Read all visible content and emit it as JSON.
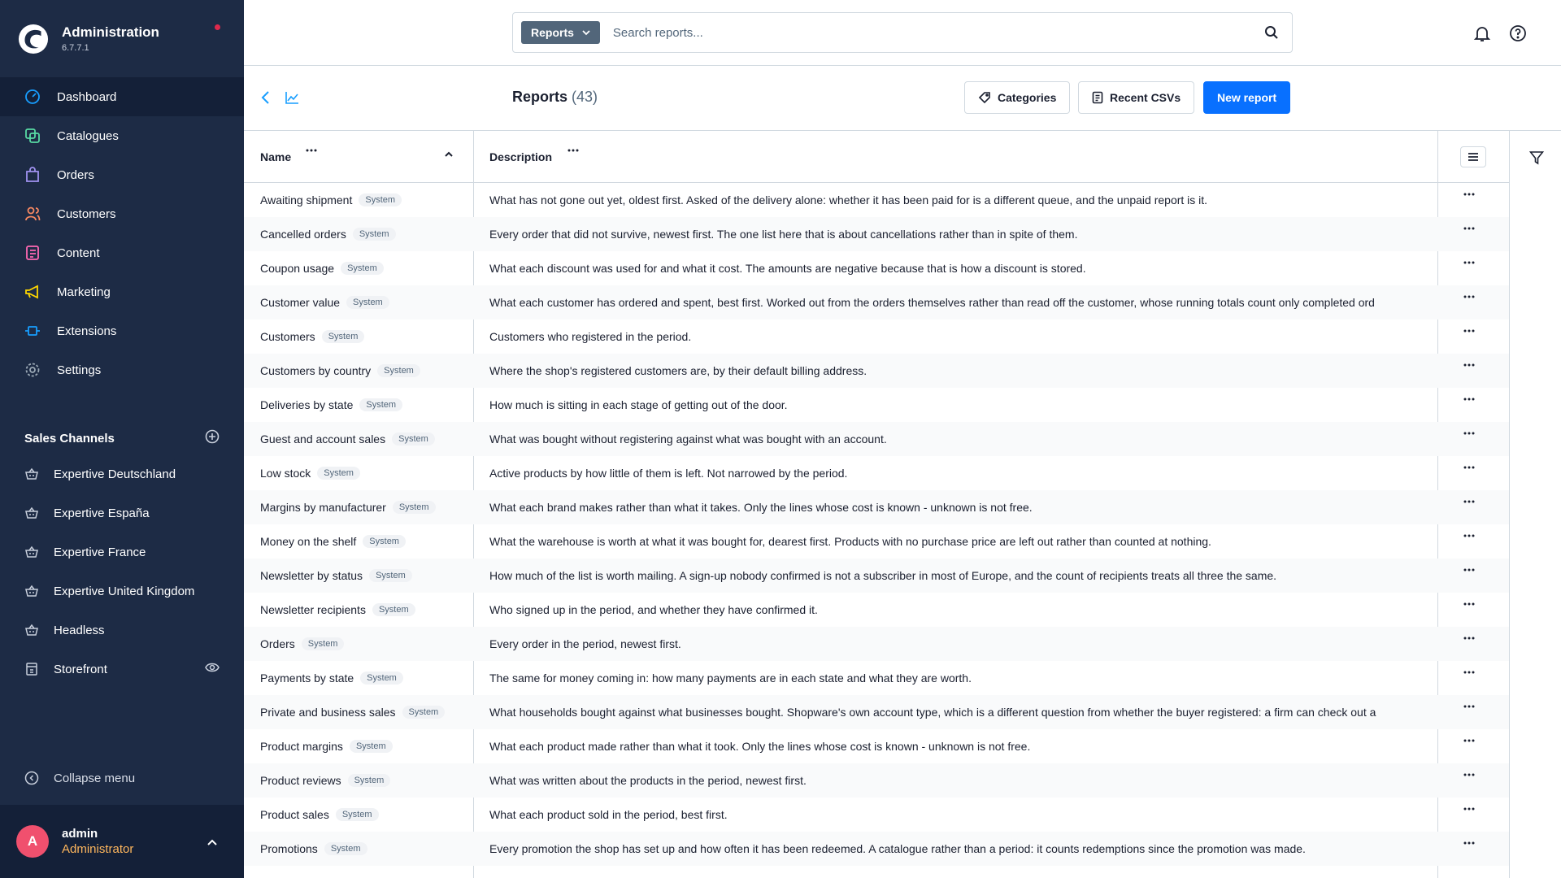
{
  "app": {
    "title": "Administration",
    "version": "6.7.7.1"
  },
  "nav": [
    {
      "label": "Dashboard",
      "icon": "dashboard-icon",
      "color": "#189eff",
      "active": true
    },
    {
      "label": "Catalogues",
      "icon": "catalogue-icon",
      "color": "#57d9a3"
    },
    {
      "label": "Orders",
      "icon": "orders-icon",
      "color": "#a092f0"
    },
    {
      "label": "Customers",
      "icon": "customers-icon",
      "color": "#f88962"
    },
    {
      "label": "Content",
      "icon": "content-icon",
      "color": "#ff68b4"
    },
    {
      "label": "Marketing",
      "icon": "marketing-icon",
      "color": "#ffd700"
    },
    {
      "label": "Extensions",
      "icon": "extensions-icon",
      "color": "#189eff"
    },
    {
      "label": "Settings",
      "icon": "settings-icon",
      "color": "#9aa8b5"
    }
  ],
  "sales_channels": {
    "heading": "Sales Channels",
    "items": [
      {
        "label": "Expertive Deutschland"
      },
      {
        "label": "Expertive España"
      },
      {
        "label": "Expertive France"
      },
      {
        "label": "Expertive United Kingdom"
      },
      {
        "label": "Headless"
      },
      {
        "label": "Storefront"
      }
    ]
  },
  "collapse_label": "Collapse menu",
  "user": {
    "initial": "A",
    "name": "admin",
    "role": "Administrator"
  },
  "search": {
    "type_label": "Reports",
    "placeholder": "Search reports..."
  },
  "page": {
    "title": "Reports",
    "count": "(43)"
  },
  "buttons": {
    "categories": "Categories",
    "recent_csvs": "Recent CSVs",
    "new_report": "New report"
  },
  "columns": {
    "name": "Name",
    "description": "Description"
  },
  "badge_label": "System",
  "rows": [
    {
      "name": "Awaiting shipment",
      "description": "What has not gone out yet, oldest first. Asked of the delivery alone: whether it has been paid for is a different queue, and the unpaid report is it."
    },
    {
      "name": "Cancelled orders",
      "description": "Every order that did not survive, newest first. The one list here that is about cancellations rather than in spite of them."
    },
    {
      "name": "Coupon usage",
      "description": "What each discount was used for and what it cost. The amounts are negative because that is how a discount is stored."
    },
    {
      "name": "Customer value",
      "description": "What each customer has ordered and spent, best first. Worked out from the orders themselves rather than read off the customer, whose running totals count only completed ord"
    },
    {
      "name": "Customers",
      "description": "Customers who registered in the period."
    },
    {
      "name": "Customers by country",
      "description": "Where the shop's registered customers are, by their default billing address."
    },
    {
      "name": "Deliveries by state",
      "description": "How much is sitting in each stage of getting out of the door."
    },
    {
      "name": "Guest and account sales",
      "description": "What was bought without registering against what was bought with an account."
    },
    {
      "name": "Low stock",
      "description": "Active products by how little of them is left. Not narrowed by the period."
    },
    {
      "name": "Margins by manufacturer",
      "description": "What each brand makes rather than what it takes. Only the lines whose cost is known - unknown is not free."
    },
    {
      "name": "Money on the shelf",
      "description": "What the warehouse is worth at what it was bought for, dearest first. Products with no purchase price are left out rather than counted at nothing."
    },
    {
      "name": "Newsletter by status",
      "description": "How much of the list is worth mailing. A sign-up nobody confirmed is not a subscriber in most of Europe, and the count of recipients treats all three the same."
    },
    {
      "name": "Newsletter recipients",
      "description": "Who signed up in the period, and whether they have confirmed it."
    },
    {
      "name": "Orders",
      "description": "Every order in the period, newest first."
    },
    {
      "name": "Payments by state",
      "description": "The same for money coming in: how many payments are in each state and what they are worth."
    },
    {
      "name": "Private and business sales",
      "description": "What households bought against what businesses bought. Shopware's own account type, which is a different question from whether the buyer registered: a firm can check out a"
    },
    {
      "name": "Product margins",
      "description": "What each product made rather than what it took. Only the lines whose cost is known - unknown is not free."
    },
    {
      "name": "Product reviews",
      "description": "What was written about the products in the period, newest first."
    },
    {
      "name": "Product sales",
      "description": "What each product sold in the period, best first."
    },
    {
      "name": "Promotions",
      "description": "Every promotion the shop has set up and how often it has been redeemed. A catalogue rather than a period: it counts redemptions since the promotion was made."
    }
  ]
}
